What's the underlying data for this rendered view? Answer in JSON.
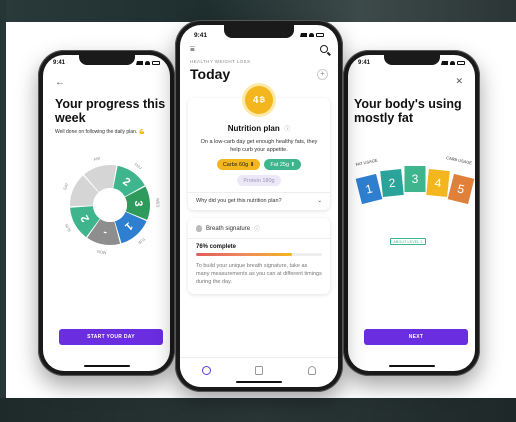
{
  "colors": {
    "accent": "#6a2de0",
    "yellow": "#f3b61f",
    "green": "#3fb58e",
    "dark_green": "#2e9a5b",
    "blue": "#2f7fd0",
    "gray": "#8e8e8e",
    "light_gray": "#d5d5d5"
  },
  "left_phone": {
    "status_time": "9:41",
    "back_icon": "arrow-left-icon",
    "title": "Your progress this week",
    "subtitle": "Well done on following the daily plan.",
    "subtitle_emoji": "💪",
    "wheel": {
      "day_labels": [
        "THU",
        "WED",
        "TUE",
        "MON",
        "SUN",
        "SAT",
        "FRI"
      ],
      "segments": [
        {
          "day": "THU",
          "value": "2",
          "color": "#3fb58e"
        },
        {
          "day": "WED",
          "value": "3",
          "color": "#2e9a5b"
        },
        {
          "day": "TUE",
          "value": "1",
          "color": "#2f7fd0"
        },
        {
          "day": "MON",
          "value": "-",
          "color": "#8e8e8e"
        },
        {
          "day": "SUN",
          "value": "2",
          "color": "#3fb58e"
        },
        {
          "day": "SAT",
          "value": "",
          "color": "#d5d5d5"
        },
        {
          "day": "FRI",
          "value": "",
          "color": "#d5d5d5"
        }
      ]
    },
    "cta_label": "START YOUR DAY"
  },
  "center_phone": {
    "status_time": "9:41",
    "eyebrow": "HEALTHY WEIGHT LOSS",
    "heading": "Today",
    "plus_label": "+",
    "nutrition": {
      "badge": "4",
      "title": "Nutrition plan",
      "info_icon": "info-icon",
      "description": "On a low-carb day get enough healthy fats, they help curb your appetite.",
      "carbs": "Carbs 60g",
      "fat": "Fat 25g",
      "protein": "Protein 180g",
      "why_label": "Why did you get this nutrition plan?"
    },
    "breath": {
      "title": "Breath signature",
      "complete_label": "76% complete",
      "progress": 0.76,
      "text": "To build your unique breath signature, take as many measurements as you can at different timings during the day."
    },
    "tabs": [
      "home-icon",
      "diary-icon",
      "profile-icon"
    ]
  },
  "right_phone": {
    "status_time": "9:41",
    "close_icon": "close-icon",
    "title": "Your body's using mostly fat",
    "fat_usage_label": "FAT USAGE",
    "carb_usage_label": "CARB USAGE",
    "levels": [
      {
        "value": "1",
        "color": "#2f7fd0"
      },
      {
        "value": "2",
        "color": "#2aa39a"
      },
      {
        "value": "3",
        "color": "#3fb58e"
      },
      {
        "value": "4",
        "color": "#f3b61f"
      },
      {
        "value": "5",
        "color": "#e0813b"
      }
    ],
    "about_label": "ABOUT LEVEL 2",
    "cta_label": "NEXT"
  }
}
